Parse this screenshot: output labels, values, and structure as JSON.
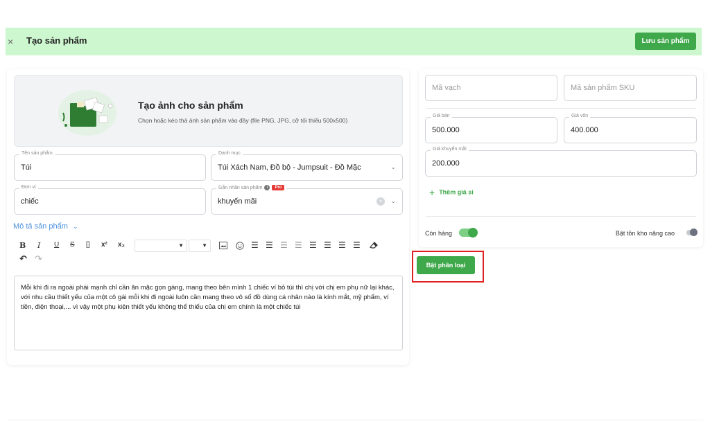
{
  "header": {
    "close_icon": "×",
    "title": "Tạo sản phẩm",
    "save_label": "Lưu sản phẩm"
  },
  "upload": {
    "title": "Tạo ảnh cho sản phẩm",
    "subtitle": "Chọn hoặc kéo thả ảnh sản phẩm vào đây (file PNG, JPG, cỡ tối thiểu 500x500)"
  },
  "fields": {
    "name": {
      "label": "Tên sản phẩm",
      "value": "Túi"
    },
    "category": {
      "label": "Danh mục",
      "value": "Túi Xách Nam, Đồ bộ - Jumpsuit - Đồ Mặc"
    },
    "unit": {
      "label": "Đơn vị",
      "value": "chiếc"
    },
    "tag": {
      "label": "Gắn nhãn sản phẩm",
      "badge": "Pro",
      "value": "khuyến mãi"
    }
  },
  "description": {
    "toggle_label": "Mô tả sản phẩm",
    "content": "Mỗi khi đi ra ngoài phái mạnh chỉ cần ăn mặc gọn gàng, mang theo bên mình 1 chiếc ví bỏ túi thì chị với chị em phụ nữ lại khác, với nhu cầu thiết yếu của một cô gái mỗi khi đi ngoài luôn cần mang theo vô số đồ dùng cá nhân nào là kính mắt, mỹ phẩm, ví tiền, điện thoại,... vì vậy một phụ kiện thiết yếu không thể thiếu của chị em chính là một chiếc túi"
  },
  "toolbar": {
    "bold": "B",
    "italic": "I",
    "underline": "U",
    "strike": "S",
    "code": "[]",
    "superscript": "x²",
    "subscript": "x₂",
    "undo": "↶",
    "redo": "↷"
  },
  "pricing": {
    "barcode_placeholder": "Mã vạch",
    "sku_placeholder": "Mã sản phẩm SKU",
    "sell_price": {
      "label": "Giá bán",
      "value": "500.000"
    },
    "cost_price": {
      "label": "Giá vốn",
      "value": "400.000"
    },
    "promo_price": {
      "label": "Giá khuyến mãi",
      "value": "200.000"
    },
    "add_wholesale_label": "Thêm giá sỉ",
    "in_stock_label": "Còn hàng",
    "in_stock_on": true,
    "advanced_inventory_label": "Bật tồn kho nâng cao",
    "advanced_inventory_on": false
  },
  "variant_button_label": "Bật phân loại",
  "colors": {
    "accent": "#3ea84a",
    "header_bg": "#cdf7cf",
    "highlight": "#e02020",
    "link": "#4a90e2"
  }
}
